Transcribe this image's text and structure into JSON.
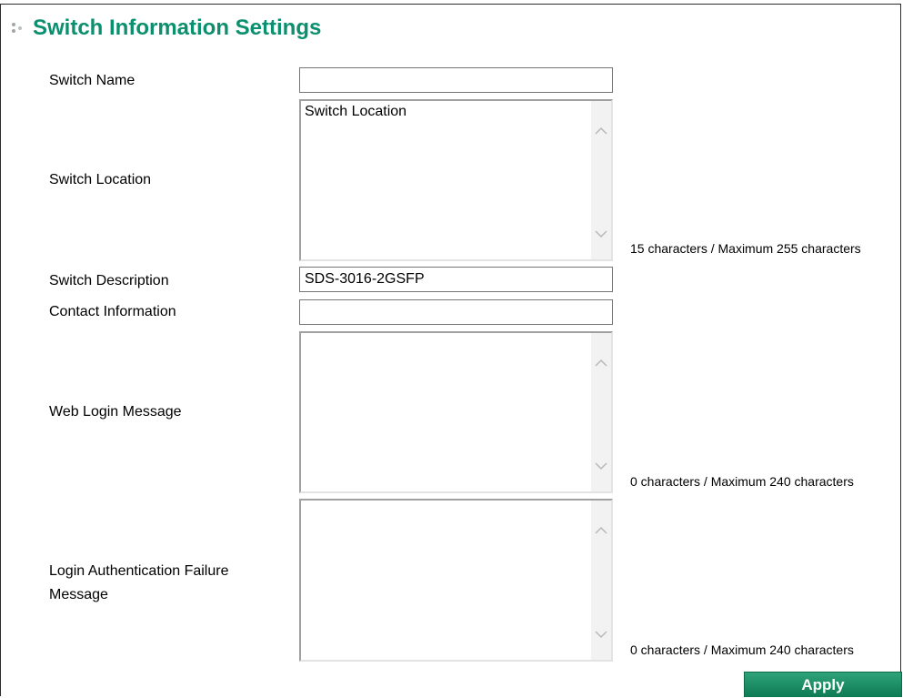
{
  "page": {
    "title": "Switch Information Settings",
    "accent_color": "#0b8f6e",
    "bullet_icon": "three-dots-icon"
  },
  "fields": {
    "switch_name": {
      "label": "Switch Name",
      "value": ""
    },
    "switch_location": {
      "label": "Switch Location",
      "value": "Switch Location",
      "hint": "15 characters / Maximum 255 characters"
    },
    "switch_description": {
      "label": "Switch Description",
      "value": "SDS-3016-2GSFP"
    },
    "contact_information": {
      "label": "Contact Information",
      "value": ""
    },
    "web_login_message": {
      "label": "Web Login Message",
      "value": "",
      "hint": "0 characters / Maximum 240 characters"
    },
    "login_auth_failure_message": {
      "label_line1": "Login Authentication Failure",
      "label_line2": "Message",
      "value": "",
      "hint": "0 characters / Maximum 240 characters"
    }
  },
  "actions": {
    "apply_label": "Apply"
  }
}
